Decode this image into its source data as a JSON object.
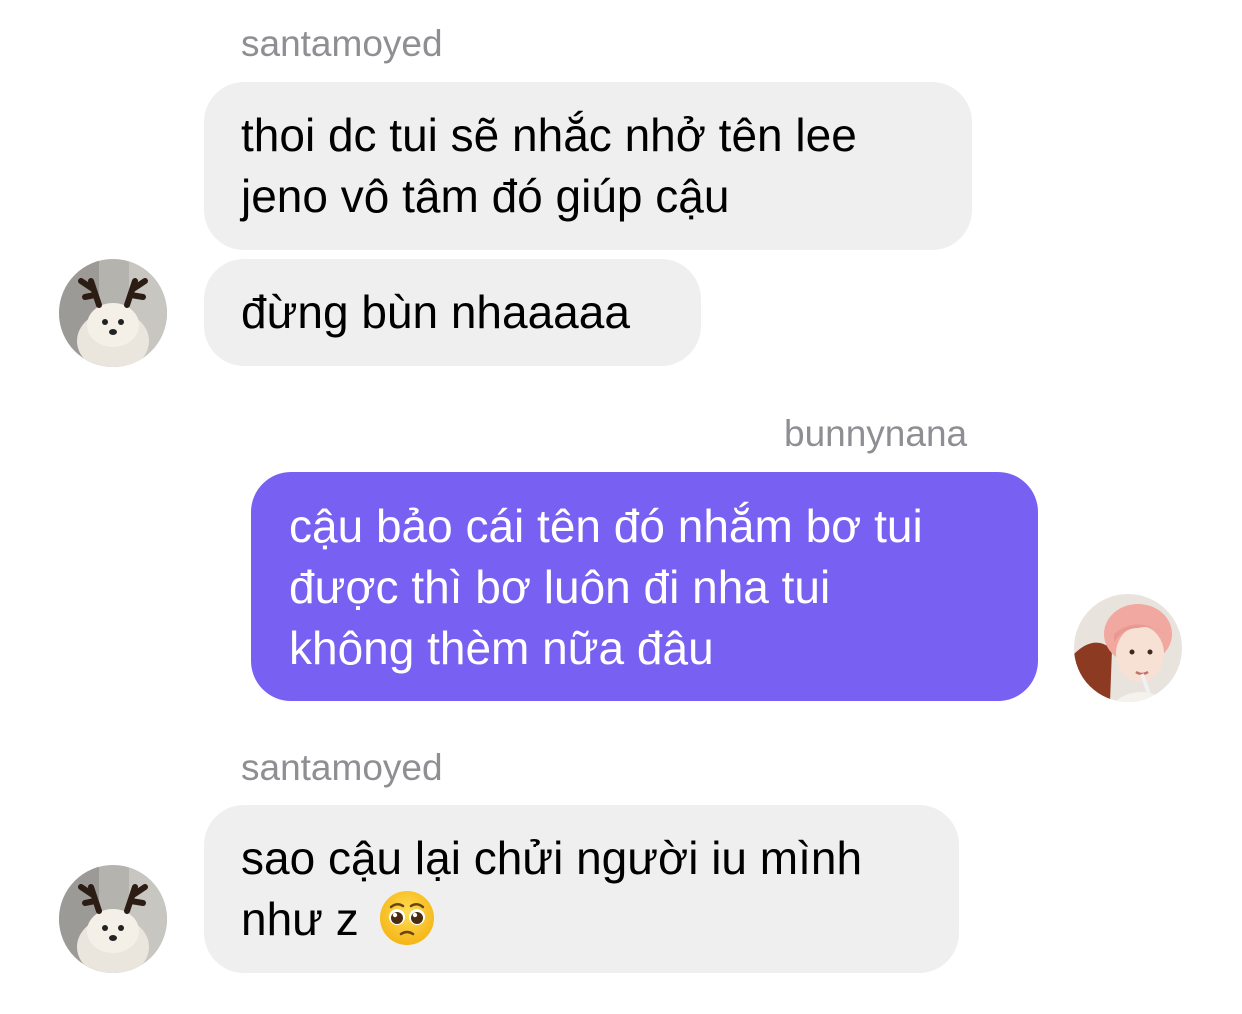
{
  "conversation": {
    "messages": [
      {
        "sender": "santamoyed",
        "bubbles": [
          {
            "lines": [
              "thoi dc tui sẽ nhắc nhở tên lee",
              "jeno vô tâm đó giúp cậu"
            ]
          },
          {
            "lines": [
              "đừng bùn nhaaaaa"
            ]
          }
        ],
        "avatar_icon": "reindeer-dog-avatar"
      },
      {
        "sender": "bunnynana",
        "bubbles": [
          {
            "lines": [
              "cậu bảo cái tên đó nhắm bơ tui",
              "được thì bơ luôn đi nha tui",
              "không thèm nữa đâu"
            ]
          }
        ],
        "avatar_icon": "pink-hair-person-avatar"
      },
      {
        "sender": "santamoyed",
        "bubbles": [
          {
            "lines": [
              "sao cậu lại chửi người iu mình",
              "như z"
            ],
            "emoji": "pleading-face-emoji"
          }
        ],
        "avatar_icon": "reindeer-dog-avatar"
      }
    ]
  },
  "colors": {
    "incoming_bubble": "#efefef",
    "outgoing_bubble": "#7860f3",
    "sender_label": "#8e8e93"
  }
}
